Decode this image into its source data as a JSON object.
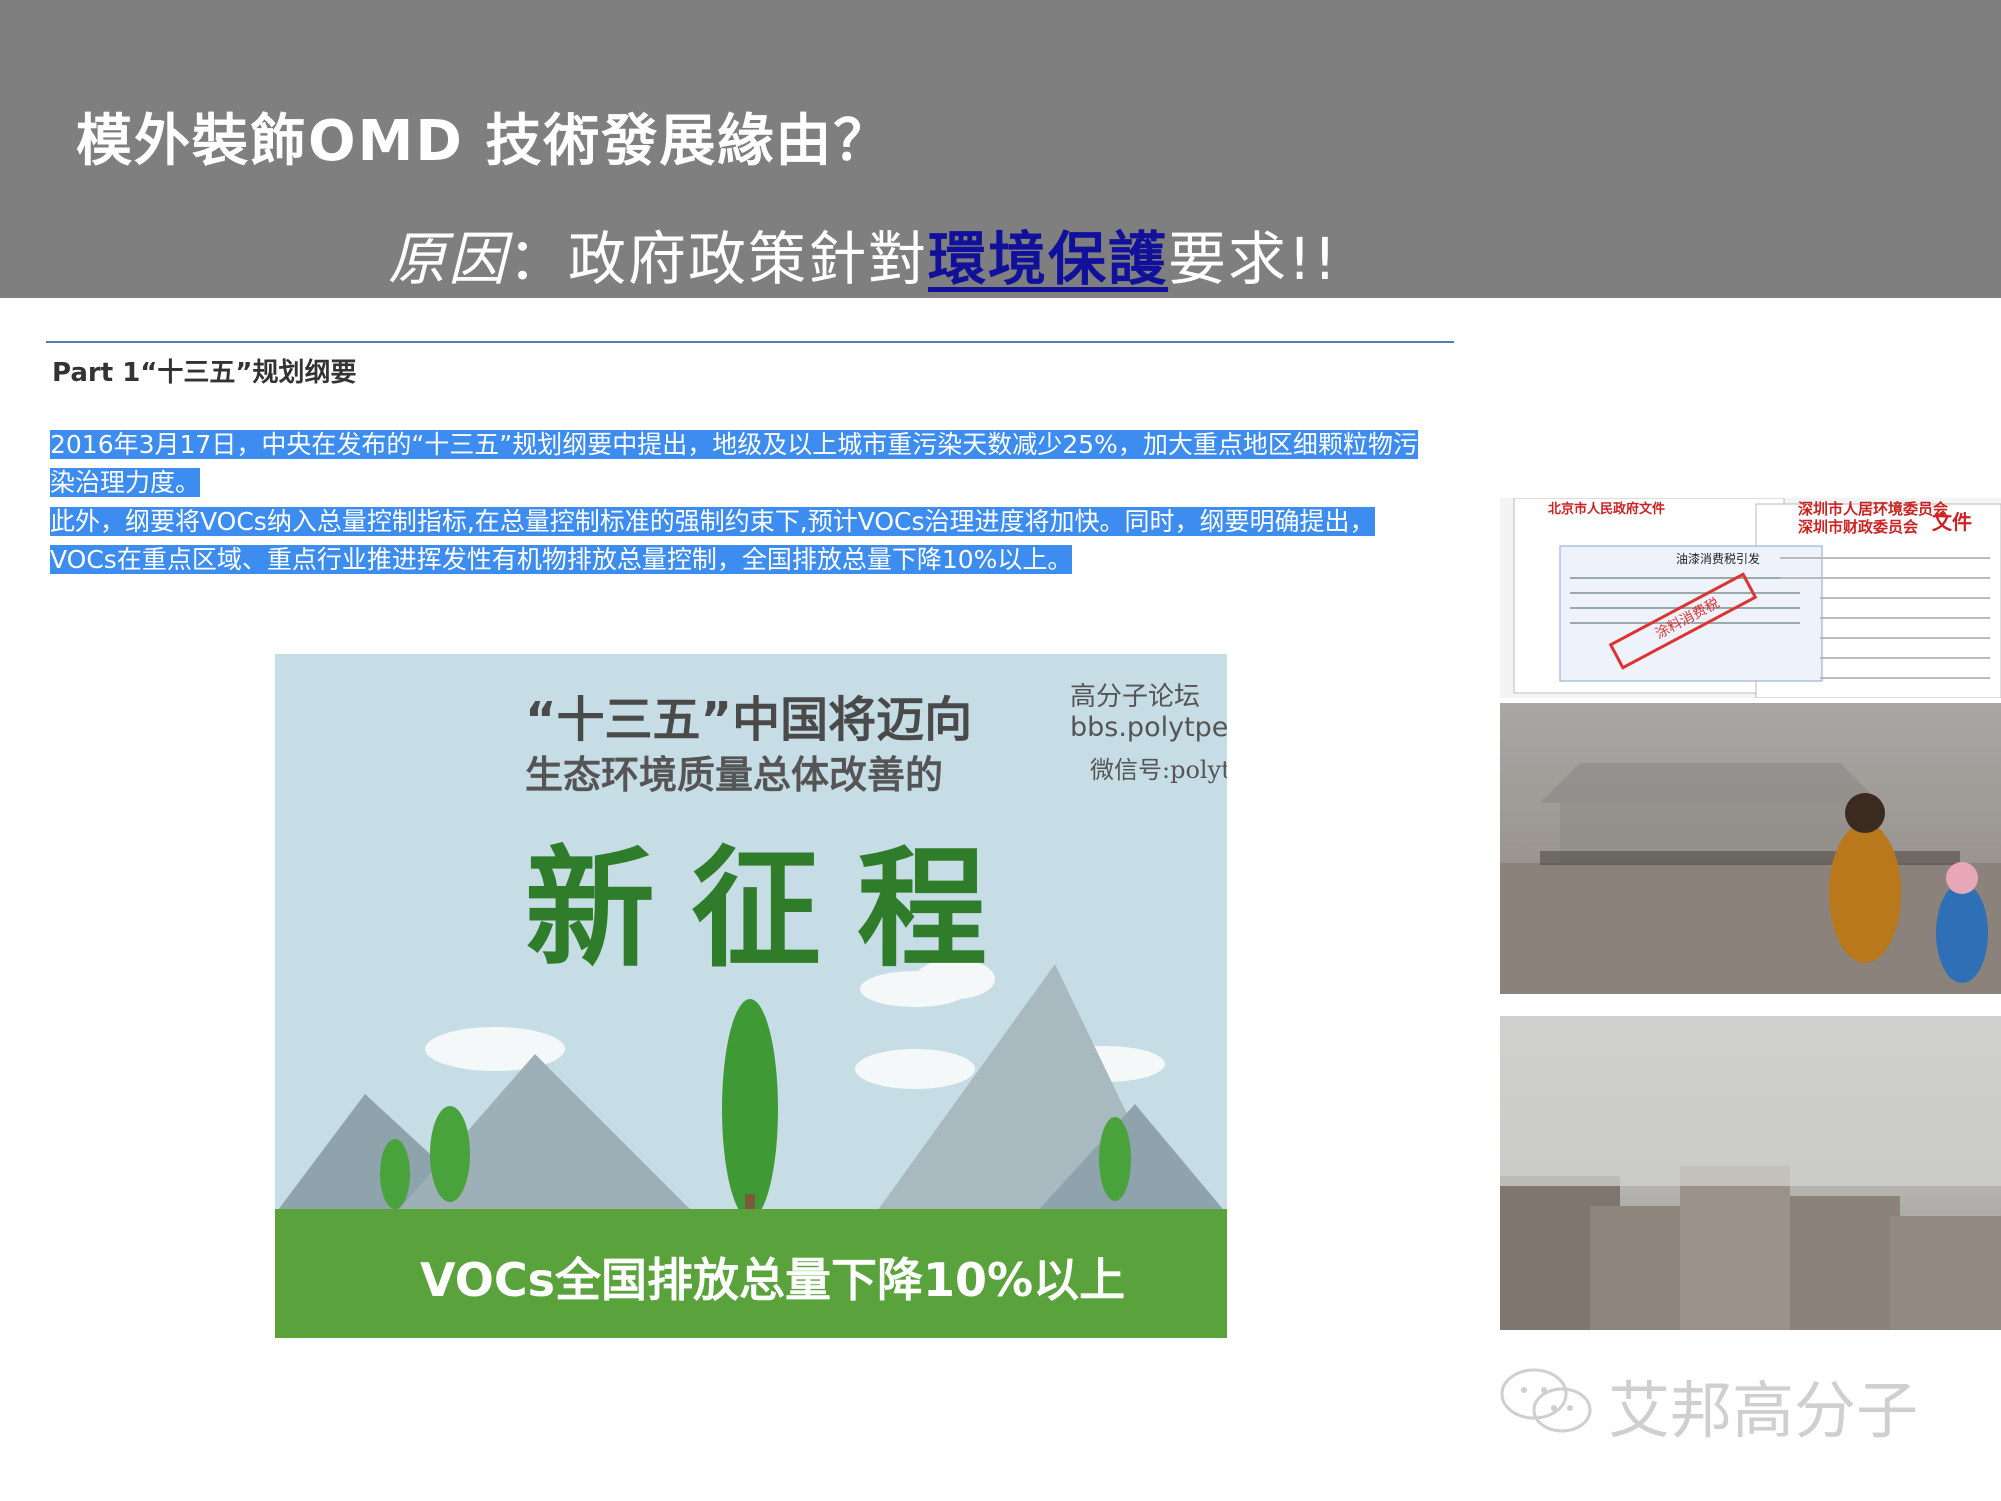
{
  "header": {
    "title": "模外裝飾OMD 技術發展緣由？",
    "subtitle_reason": "原因",
    "subtitle_mid": "：政府政策針對",
    "subtitle_highlight": "環境保護",
    "subtitle_end": "要求!!"
  },
  "document": {
    "heading": "Part 1“十三五”规划纲要",
    "paragraph1_line1": "2016年3月17日，中央在发布的“十三五”规划纲要中提出，地级及以上城市重污染天数减少25%，加大重点地区细颗粒物污",
    "paragraph1_line2": "染治理力度。",
    "paragraph2_line1": "此外，纲要将VOCs纳入总量控制指标,在总量控制标准的强制约束下,预计VOCs治理进度将加快。同时，纲要明确提出，",
    "paragraph2_line2": "VOCs在重点区域、重点行业推进挥发性有机物排放总量控制，全国排放总量下降10%以上。"
  },
  "poster": {
    "title": "“十三五”中国将迈向",
    "subtitle": "生态环境质量总体改善的",
    "main": "新征程",
    "forum": "高分子论坛",
    "site": "bbs.polytpe.com",
    "wechat": "微信号:polytpe",
    "bottom": "VOCs全国排放总量下降10%以上"
  },
  "photos": {
    "doc_left_header": "北京市人民政府文件",
    "doc_right_header1": "深圳市人居环境委员会",
    "doc_right_header2": "深圳市财政委员会",
    "doc_right_file": "文件",
    "doc_popup_title": "油漆消费税引发",
    "doc_stamp": "涂料消费税"
  },
  "watermark": {
    "text": "艾邦高分子"
  },
  "colors": {
    "header_bg": "#7f7f7f",
    "highlight": "#10109a",
    "selection": "#3d8cf0",
    "poster_green": "#2f7d2a"
  }
}
